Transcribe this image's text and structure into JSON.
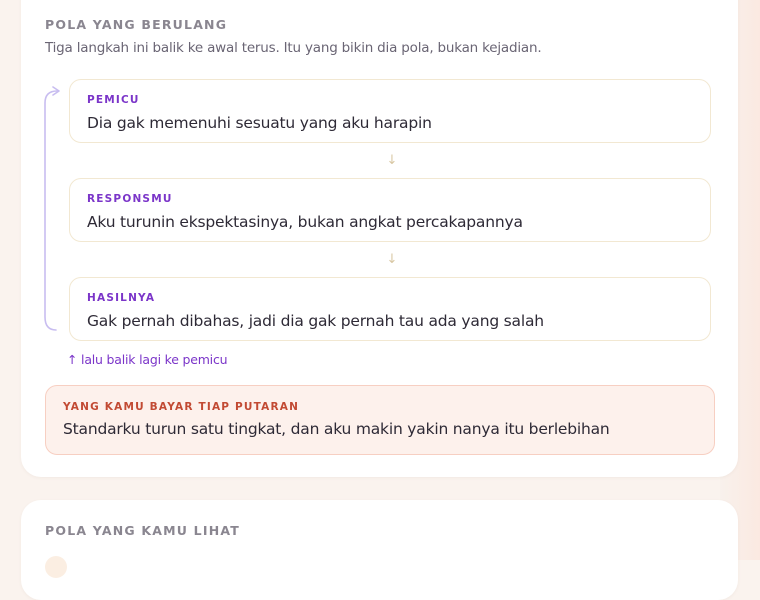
{
  "pattern": {
    "title": "POLA YANG BERULANG",
    "subtitle": "Tiga langkah ini balik ke awal terus. Itu yang bikin dia pola, bukan kejadian.",
    "steps": [
      {
        "tag": "PEMICU",
        "text": "Dia gak memenuhi sesuatu yang aku harapin"
      },
      {
        "tag": "RESPONSMU",
        "text": "Aku turunin ekspektasinya, bukan angkat percakapannya"
      },
      {
        "tag": "HASILNYA",
        "text": "Gak pernah dibahas, jadi dia gak pernah tau ada yang salah"
      }
    ],
    "down_arrow": "↓",
    "loop_note": "↑ lalu balik lagi ke pemicu",
    "cost": {
      "tag": "YANG KAMU BAYAR TIAP PUTARAN",
      "text": "Standarku turun satu tingkat, dan aku makin yakin nanya itu berlebihan"
    }
  },
  "seen": {
    "title": "POLA YANG KAMU LIHAT"
  },
  "colors": {
    "accent_purple": "#7b35c9",
    "cost_red": "#c24a33",
    "step_border": "#f2e8d2",
    "cost_bg": "#fdf1ec"
  }
}
